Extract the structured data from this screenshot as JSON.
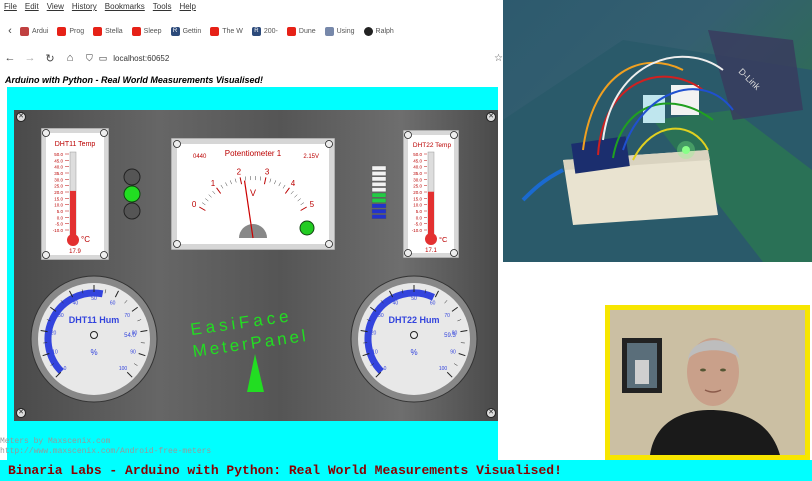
{
  "menu": [
    "File",
    "Edit",
    "View",
    "History",
    "Bookmarks",
    "Tools",
    "Help"
  ],
  "bookmarks": [
    {
      "label": "Ardui",
      "icon": "arduino-icon"
    },
    {
      "label": "Prog",
      "icon": "youtube-icon"
    },
    {
      "label": "Stella",
      "icon": "youtube-icon"
    },
    {
      "label": "Sleep",
      "icon": "youtube-icon"
    },
    {
      "label": "Gettin",
      "icon": "r-icon"
    },
    {
      "label": "The W",
      "icon": "youtube-icon"
    },
    {
      "label": "200-",
      "icon": "r-icon"
    },
    {
      "label": "Dune",
      "icon": "youtube-icon"
    },
    {
      "label": "Using",
      "icon": "doc-icon"
    },
    {
      "label": "Ralph",
      "icon": "github-icon"
    }
  ],
  "url": "localhost:60652",
  "app_title": "Arduino with Python - Real World Measurements Visualised!",
  "dht11_temp": {
    "title": "DHT11 Temp",
    "unit": "°C",
    "value": "17.9",
    "scale": [
      "50.0",
      "45.0",
      "40.0",
      "35.0",
      "30.0",
      "25.0",
      "20.0",
      "15.0",
      "10.0",
      "5.0",
      "0.0",
      "-5.0",
      "-10.0"
    ],
    "fill_fraction": 0.55
  },
  "dht22_temp": {
    "title": "DHT22 Temp",
    "unit": "°C",
    "value": "17.1",
    "scale": [
      "50.0",
      "45.0",
      "40.0",
      "35.0",
      "30.0",
      "25.0",
      "20.0",
      "15.0",
      "10.0",
      "5.0",
      "0.0",
      "-5.0",
      "-10.0"
    ],
    "fill_fraction": 0.54
  },
  "potentiometer": {
    "title": "Potentiometer 1",
    "raw": "0440",
    "volts": "2.15V",
    "unit": "V",
    "ticks": [
      "0",
      "1",
      "2",
      "3",
      "4",
      "5"
    ],
    "value": 2.15,
    "max": 5
  },
  "leds": [
    "off",
    "on",
    "off"
  ],
  "bar_meter": {
    "segments": 10,
    "lit_green": 2,
    "lit_blue": 3
  },
  "dht11_hum": {
    "title": "DHT11 Hum",
    "unit": "%",
    "value": "54.0",
    "ticks": [
      "0",
      "10",
      "20",
      "30",
      "40",
      "50",
      "60",
      "70",
      "80",
      "90",
      "100"
    ],
    "fraction": 0.54
  },
  "dht22_hum": {
    "title": "DHT22 Hum",
    "unit": "%",
    "value": "59.3",
    "ticks": [
      "0",
      "10",
      "20",
      "30",
      "40",
      "50",
      "60",
      "70",
      "80",
      "90",
      "100"
    ],
    "fraction": 0.593
  },
  "logo": {
    "line1": "EasiFace",
    "line2": "MeterPanel"
  },
  "credit": {
    "line1": "Meters by Maxscenix.com",
    "line2": "http://www.maxscenix.com/Android-free-meters"
  },
  "footer": "Binaria Labs - Arduino with Python: Real World Measurements Visualised!",
  "colors": {
    "cyan": "#00ffff",
    "footer_text": "#8b0000",
    "webcam_border": "#f7e600",
    "mercury": "#e33030",
    "hum_arc": "#3344dd"
  }
}
